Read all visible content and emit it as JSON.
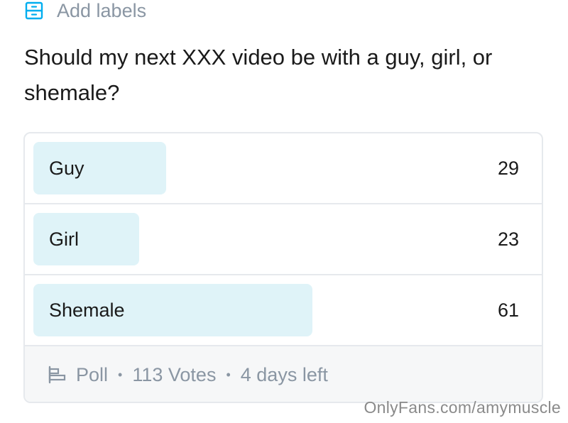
{
  "labels_link": {
    "text": "Add labels",
    "icon": "label-box-icon"
  },
  "question": "Should my next XXX video be with a guy, girl, or shemale?",
  "poll": {
    "options": [
      {
        "label": "Guy",
        "votes": "29",
        "fill_fraction": 0.257
      },
      {
        "label": "Girl",
        "votes": "23",
        "fill_fraction": 0.204
      },
      {
        "label": "Shemale",
        "votes": "61",
        "fill_fraction": 0.54
      }
    ],
    "footer": {
      "icon": "poll-icon",
      "type_label": "Poll",
      "separator": "•",
      "votes_text": "113 Votes",
      "time_left": "4 days left"
    }
  },
  "colors": {
    "accent": "#00aeef",
    "option_fill": "#dff3f8",
    "muted_text": "#8a96a3",
    "border": "#e6e9ed"
  },
  "watermark": "OnlyFans.com/amymuscle"
}
